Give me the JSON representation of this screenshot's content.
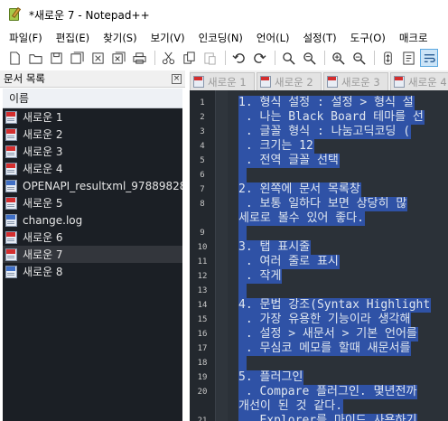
{
  "window": {
    "title": "*새로운 7 - Notepad++"
  },
  "menu": [
    "파일(F)",
    "편집(E)",
    "찾기(S)",
    "보기(V)",
    "인코딩(N)",
    "언어(L)",
    "설정(T)",
    "도구(O)",
    "매크로"
  ],
  "toolbar": {
    "icons": [
      "new-file-icon",
      "open-file-icon",
      "save-icon",
      "save-all-icon",
      "close-icon",
      "close-all-icon",
      "print-icon",
      "cut-icon",
      "copy-icon",
      "paste-icon",
      "undo-icon",
      "redo-icon",
      "find-icon",
      "replace-icon",
      "zoom-in-icon",
      "zoom-out-icon",
      "sync-scroll-icon",
      "word-wrap-icon",
      "wrap-toggle-icon"
    ]
  },
  "panel": {
    "title": "문서 목록",
    "close_glyph": "×",
    "column_header": "이름",
    "items": [
      {
        "label": "새로운 1",
        "icon": "red",
        "selected": false
      },
      {
        "label": "새로운 2",
        "icon": "red",
        "selected": false
      },
      {
        "label": "새로운 3",
        "icon": "red",
        "selected": false
      },
      {
        "label": "새로운 4",
        "icon": "red",
        "selected": false
      },
      {
        "label": "OPENAPI_resultxml_97889828...",
        "icon": "blue",
        "selected": false
      },
      {
        "label": "새로운 5",
        "icon": "red",
        "selected": false
      },
      {
        "label": "change.log",
        "icon": "blue",
        "selected": false
      },
      {
        "label": "새로운 6",
        "icon": "red",
        "selected": false
      },
      {
        "label": "새로운 7",
        "icon": "red",
        "selected": true
      },
      {
        "label": "새로운 8",
        "icon": "blue",
        "selected": false
      }
    ]
  },
  "tabs": [
    "새로운 1",
    "새로운 2",
    "새로운 3",
    "새로운 4"
  ],
  "editor": {
    "lines": [
      {
        "n": "1",
        "text": "1. 형식 설정 : 설정 > 형식 설"
      },
      {
        "n": "2",
        "text": " . 나는 Black Board 테마를 선"
      },
      {
        "n": "3",
        "text": " . 글꼴 형식 : 나눔고딕코딩 ("
      },
      {
        "n": "4",
        "text": " . 크기는 12"
      },
      {
        "n": "5",
        "text": " . 전역 글꼴 선택"
      },
      {
        "n": "6",
        "text": " "
      },
      {
        "n": "7",
        "text": "2. 왼쪽에 문서 목록창"
      },
      {
        "n": "8",
        "text": " . 보통 일하다 보면 상당히 많"
      },
      {
        "n": "",
        "text": "세로로 볼수 있어 좋다."
      },
      {
        "n": "9",
        "text": " "
      },
      {
        "n": "10",
        "text": "3. 탭 표시줄"
      },
      {
        "n": "11",
        "text": " . 여러 줄로 표시"
      },
      {
        "n": "12",
        "text": " . 작게"
      },
      {
        "n": "13",
        "text": " "
      },
      {
        "n": "14",
        "text": "4. 문법 강조(Syntax Highlight"
      },
      {
        "n": "15",
        "text": " . 가장 유용한 기능이라 생각해"
      },
      {
        "n": "16",
        "text": " . 설정 > 새문서 > 기본 언어를"
      },
      {
        "n": "17",
        "text": " . 무심코 메모를 할때 새문서를"
      },
      {
        "n": "18",
        "text": " "
      },
      {
        "n": "19",
        "text": "5. 플러그인"
      },
      {
        "n": "20",
        "text": " . Compare 플러그인. 몇년전까"
      },
      {
        "n": "",
        "text": "개선이 된 것 같다."
      },
      {
        "n": "21",
        "text": " . Explorer를 마이드 사용하기"
      }
    ]
  }
}
